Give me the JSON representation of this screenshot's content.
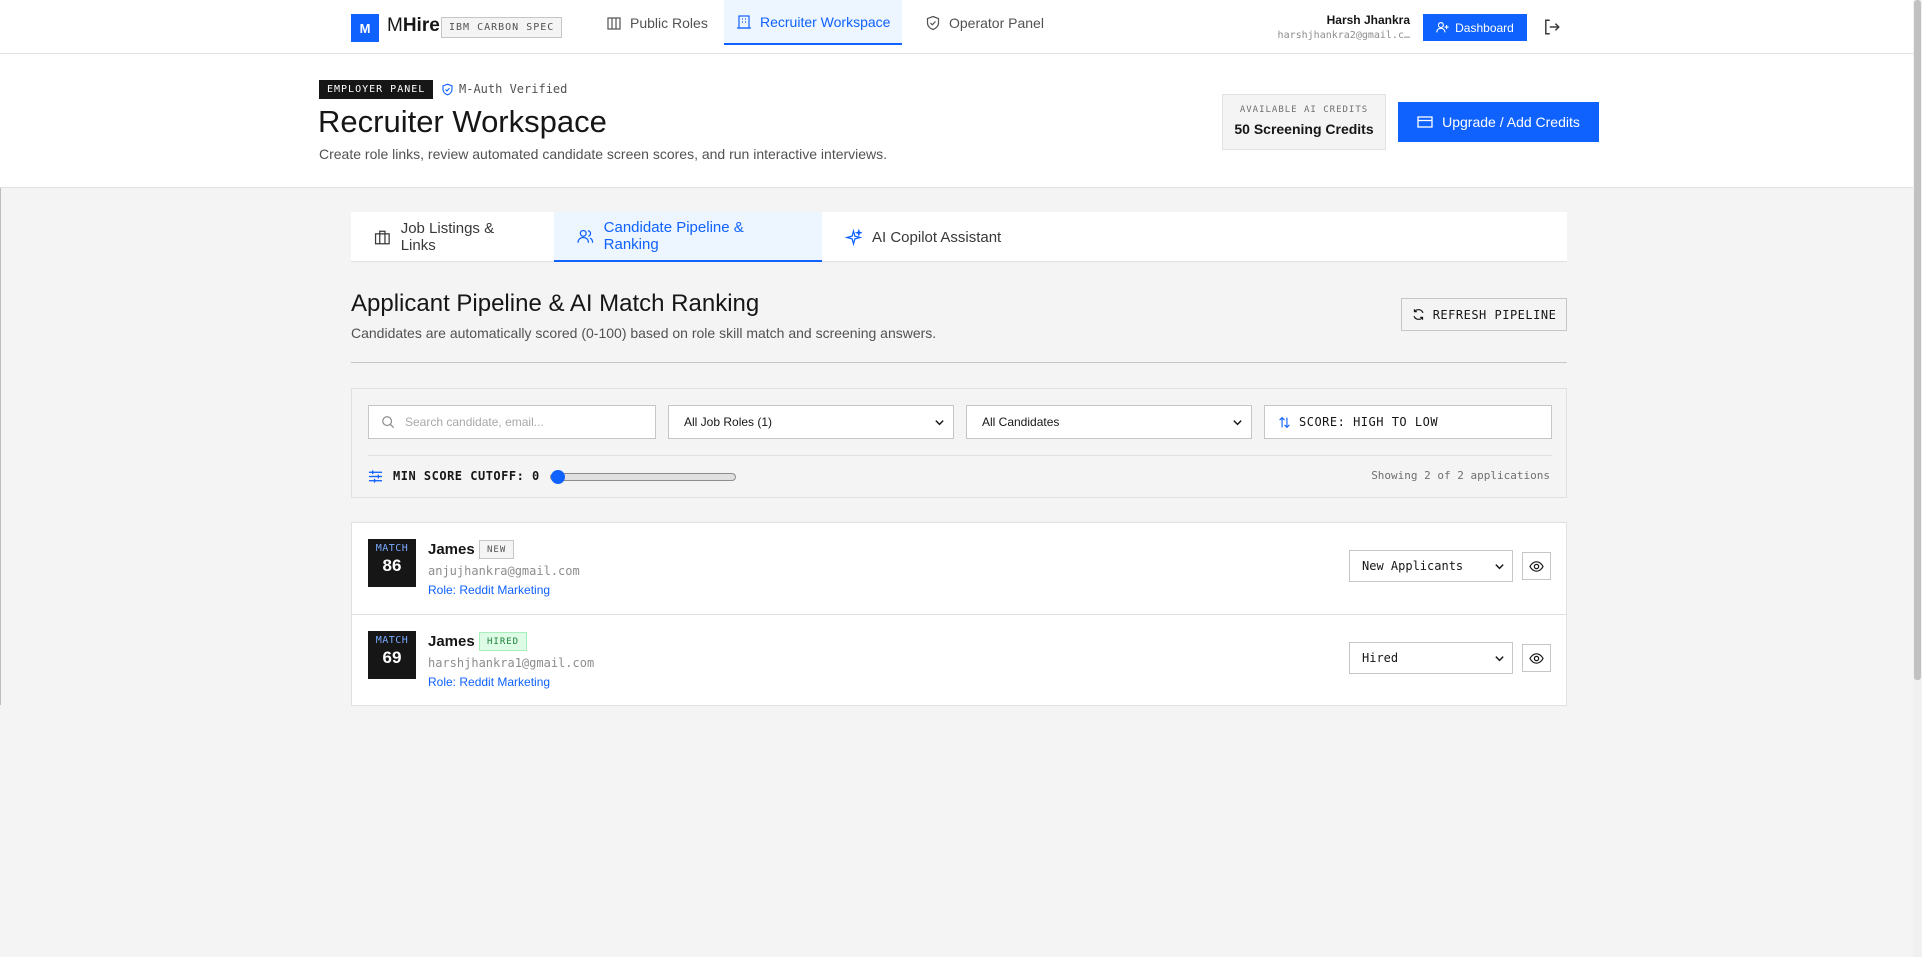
{
  "brand": {
    "logo_letter": "M",
    "name_prefix": "M",
    "name_bold": "Hire",
    "tag": "IBM CARBON SPEC"
  },
  "nav": {
    "links": [
      {
        "label": "Public Roles",
        "icon": "building-icon",
        "active": false
      },
      {
        "label": "Recruiter Workspace",
        "icon": "office-icon",
        "active": true
      },
      {
        "label": "Operator Panel",
        "icon": "shield-icon",
        "active": false
      }
    ],
    "user_name": "Harsh Jhankra",
    "user_email": "harshjhankra2@gmail.c…",
    "dashboard_label": "Dashboard"
  },
  "header": {
    "badge": "EMPLOYER PANEL",
    "verified": "M-Auth Verified",
    "title": "Recruiter Workspace",
    "subtitle": "Create role links, review automated candidate screen scores, and run interactive interviews.",
    "credits_label": "AVAILABLE AI CREDITS",
    "credits_value": "50 Screening Credits",
    "upgrade_label": "Upgrade / Add Credits"
  },
  "tabs": [
    {
      "label": "Job Listings & Links",
      "icon": "briefcase-icon",
      "active": false
    },
    {
      "label": "Candidate Pipeline & Ranking",
      "icon": "users-icon",
      "active": true
    },
    {
      "label": "AI Copilot Assistant",
      "icon": "sparkle-icon",
      "active": false
    }
  ],
  "section": {
    "title": "Applicant Pipeline & AI Match Ranking",
    "subtitle": "Candidates are automatically scored (0-100) based on role skill match and screening answers.",
    "refresh_label": "REFRESH PIPELINE"
  },
  "filters": {
    "search_placeholder": "Search candidate, email...",
    "job_roles": "All Job Roles (1)",
    "candidates": "All Candidates",
    "sort": "SCORE: HIGH TO LOW",
    "cutoff_label": "MIN SCORE CUTOFF: 0",
    "cutoff_value": 0,
    "showing": "Showing 2 of 2 applications"
  },
  "candidates": [
    {
      "match_label": "MATCH",
      "score": "86",
      "name": "James",
      "status_tag": "NEW",
      "email": "anjujhankra@gmail.com",
      "role": "Role: Reddit Marketing",
      "stage": "New Applicants"
    },
    {
      "match_label": "MATCH",
      "score": "69",
      "name": "James",
      "status_tag": "HIRED",
      "email": "harshjhankra1@gmail.com",
      "role": "Role: Reddit Marketing",
      "stage": "Hired"
    }
  ],
  "colors": {
    "accent": "#0f62fe",
    "dark": "#161616",
    "hired_bg": "#defbe6",
    "hired_text": "#198038"
  }
}
